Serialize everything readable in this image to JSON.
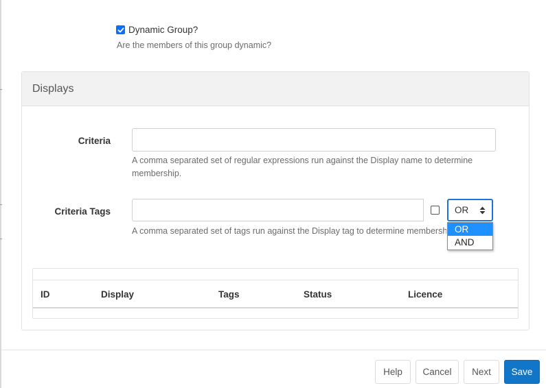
{
  "dynamic_group": {
    "checked": true,
    "label": "Dynamic Group?",
    "help": "Are the members of this group dynamic?"
  },
  "displays_panel": {
    "title": "Displays",
    "criteria": {
      "label": "Criteria",
      "value": "",
      "help": "A comma separated set of regular expressions run against the Display name to determine membership."
    },
    "criteria_tags": {
      "label": "Criteria Tags",
      "value": "",
      "exact_match_checked": false,
      "help": "A comma separated set of tags run against the Display tag to determine membersh",
      "operator_selected": "OR",
      "operator_options": [
        "OR",
        "AND"
      ]
    },
    "table": {
      "columns": [
        "ID",
        "Display",
        "Tags",
        "Status",
        "Licence"
      ]
    }
  },
  "footer": {
    "help_label": "Help",
    "cancel_label": "Cancel",
    "next_label": "Next",
    "save_label": "Save"
  },
  "colors": {
    "primary_button": "#1175c8",
    "checkbox_accent": "#0d6efd",
    "dropdown_highlight": "#1e90ff",
    "panel_header_bg": "#f2f2f2"
  }
}
